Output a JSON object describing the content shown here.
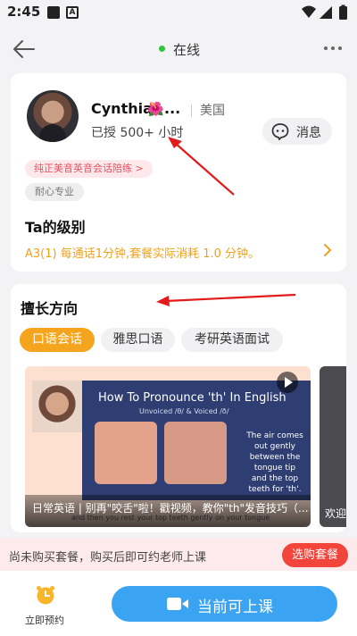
{
  "status_bar": {
    "time": "2:45",
    "notif_letter": "A"
  },
  "nav": {
    "status": "在线"
  },
  "profile": {
    "name": "Cynthia",
    "flag_emoji": "🌺",
    "ellipsis": "...",
    "country": "美国",
    "taught": "已授 500+ 小时",
    "message_label": "消息",
    "tags": [
      "纯正美音英音会话陪练 >",
      "耐心专业"
    ],
    "level_title": "Ta的级别",
    "level_desc": "A3(1) 每通话1分钟,套餐实际消耗 1.0 分钟。"
  },
  "specialties": {
    "title": "擅长方向",
    "chips": [
      "口语会话",
      "雅思口语",
      "考研英语面试"
    ],
    "video": {
      "headline": "How To Pronounce 'th' In English",
      "sub": "Unvoiced /θ/ & Voiced /ð/",
      "note": "The air comes out gently between the tongue tip and the top teeth for 'th'.",
      "caption": "日常英语 | 别再\"咬舌\"啦！戳视频，教你\"th\"发音技巧（...",
      "subtitle": "and then you rest your top teeth gently on your tongue"
    },
    "video2_caption": "欢迎"
  },
  "notice": {
    "text": "尚未购买套餐，购买后即可约老师上课",
    "button": "选购套餐"
  },
  "bottom_bar": {
    "book_label": "立即预约",
    "start_label": "当前可上课"
  },
  "colors": {
    "accent_orange": "#f5a41d",
    "online_green": "#33c43f",
    "primary_blue": "#3aa4f2",
    "buy_red": "#f2443b",
    "annotation_red": "#e21b1b"
  }
}
